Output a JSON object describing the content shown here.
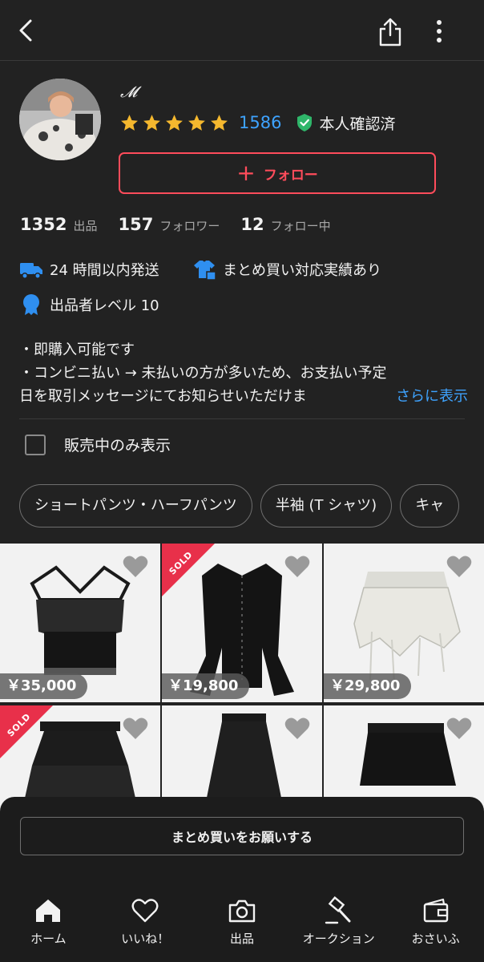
{
  "header": {
    "back_icon": "chevron-left-icon",
    "share_icon": "share-icon",
    "more_icon": "more-vertical-icon"
  },
  "profile": {
    "name": "𝓜",
    "rating_stars": 5,
    "review_count": "1586",
    "verified_label": "本人確認済",
    "follow_label": "フォロー"
  },
  "stats": [
    {
      "value": "1352",
      "label": "出品"
    },
    {
      "value": "157",
      "label": "フォロワー"
    },
    {
      "value": "12",
      "label": "フォロー中"
    }
  ],
  "badges": {
    "shipping": "24 時間以内発送",
    "bulk": "まとめ買い対応実績あり",
    "level": "出品者レベル 10"
  },
  "description": {
    "line1": "・即購入可能です",
    "line2": "・コンビニ払い → 未払いの方が多いため、お支払い予定",
    "line3": "日を取引メッセージにてお知らせいただけま",
    "more_link": "さらに表示"
  },
  "filter": {
    "on_sale_only_label": "販売中のみ表示",
    "checked": false
  },
  "categories": [
    "ショートパンツ・ハーフパンツ",
    "半袖 (T シャツ)",
    "キャ"
  ],
  "items": [
    {
      "price": "￥35,000",
      "sold": false,
      "sold_label": ""
    },
    {
      "price": "￥19,800",
      "sold": true,
      "sold_label": "SOLD"
    },
    {
      "price": "￥29,800",
      "sold": false,
      "sold_label": ""
    },
    {
      "price": "",
      "sold": true,
      "sold_label": "SOLD"
    },
    {
      "price": "",
      "sold": false,
      "sold_label": ""
    },
    {
      "price": "",
      "sold": false,
      "sold_label": ""
    }
  ],
  "bulk_request_label": "まとめ買いをお願いする",
  "tabs": [
    {
      "label": "ホーム",
      "icon": "home-icon"
    },
    {
      "label": "いいね！",
      "icon": "heart-icon"
    },
    {
      "label": "出品",
      "icon": "camera-icon"
    },
    {
      "label": "オークション",
      "icon": "gavel-icon"
    },
    {
      "label": "おさいふ",
      "icon": "wallet-icon"
    }
  ],
  "colors": {
    "background": "#222222",
    "accent_red": "#ff4c5b",
    "link_blue": "#3ea3ff",
    "star_yellow": "#f5b82e",
    "verified_green": "#2fb66a",
    "badge_blue": "#2f8ff0",
    "sold_red": "#e8304a"
  }
}
